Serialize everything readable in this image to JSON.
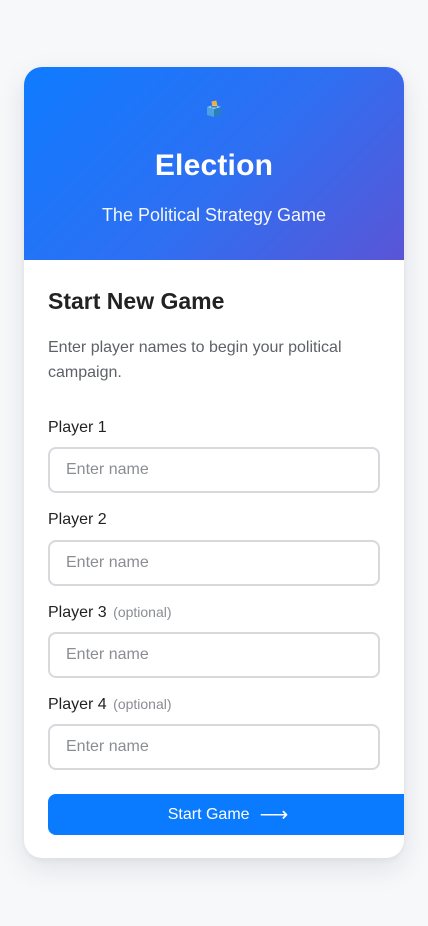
{
  "hero": {
    "icon": "ballot-box-icon",
    "title": "Election",
    "subtitle": "The Political Strategy Game"
  },
  "main": {
    "heading": "Start New Game",
    "intro": "Enter player names to begin your political campaign."
  },
  "players": [
    {
      "label": "Player 1",
      "optional": "",
      "placeholder": "Enter name",
      "value": ""
    },
    {
      "label": "Player 2",
      "optional": "",
      "placeholder": "Enter name",
      "value": ""
    },
    {
      "label": "Player 3",
      "optional": "(optional)",
      "placeholder": "Enter name",
      "value": ""
    },
    {
      "label": "Player 4",
      "optional": "(optional)",
      "placeholder": "Enter name",
      "value": ""
    }
  ],
  "start_button": {
    "label": "Start Game",
    "icon": "arrow-right-icon",
    "arrow": "⟶"
  },
  "colors": {
    "accent": "#0a7bff",
    "hero_gradient_start": "#0f7bff",
    "hero_gradient_end": "#5a55d6"
  }
}
